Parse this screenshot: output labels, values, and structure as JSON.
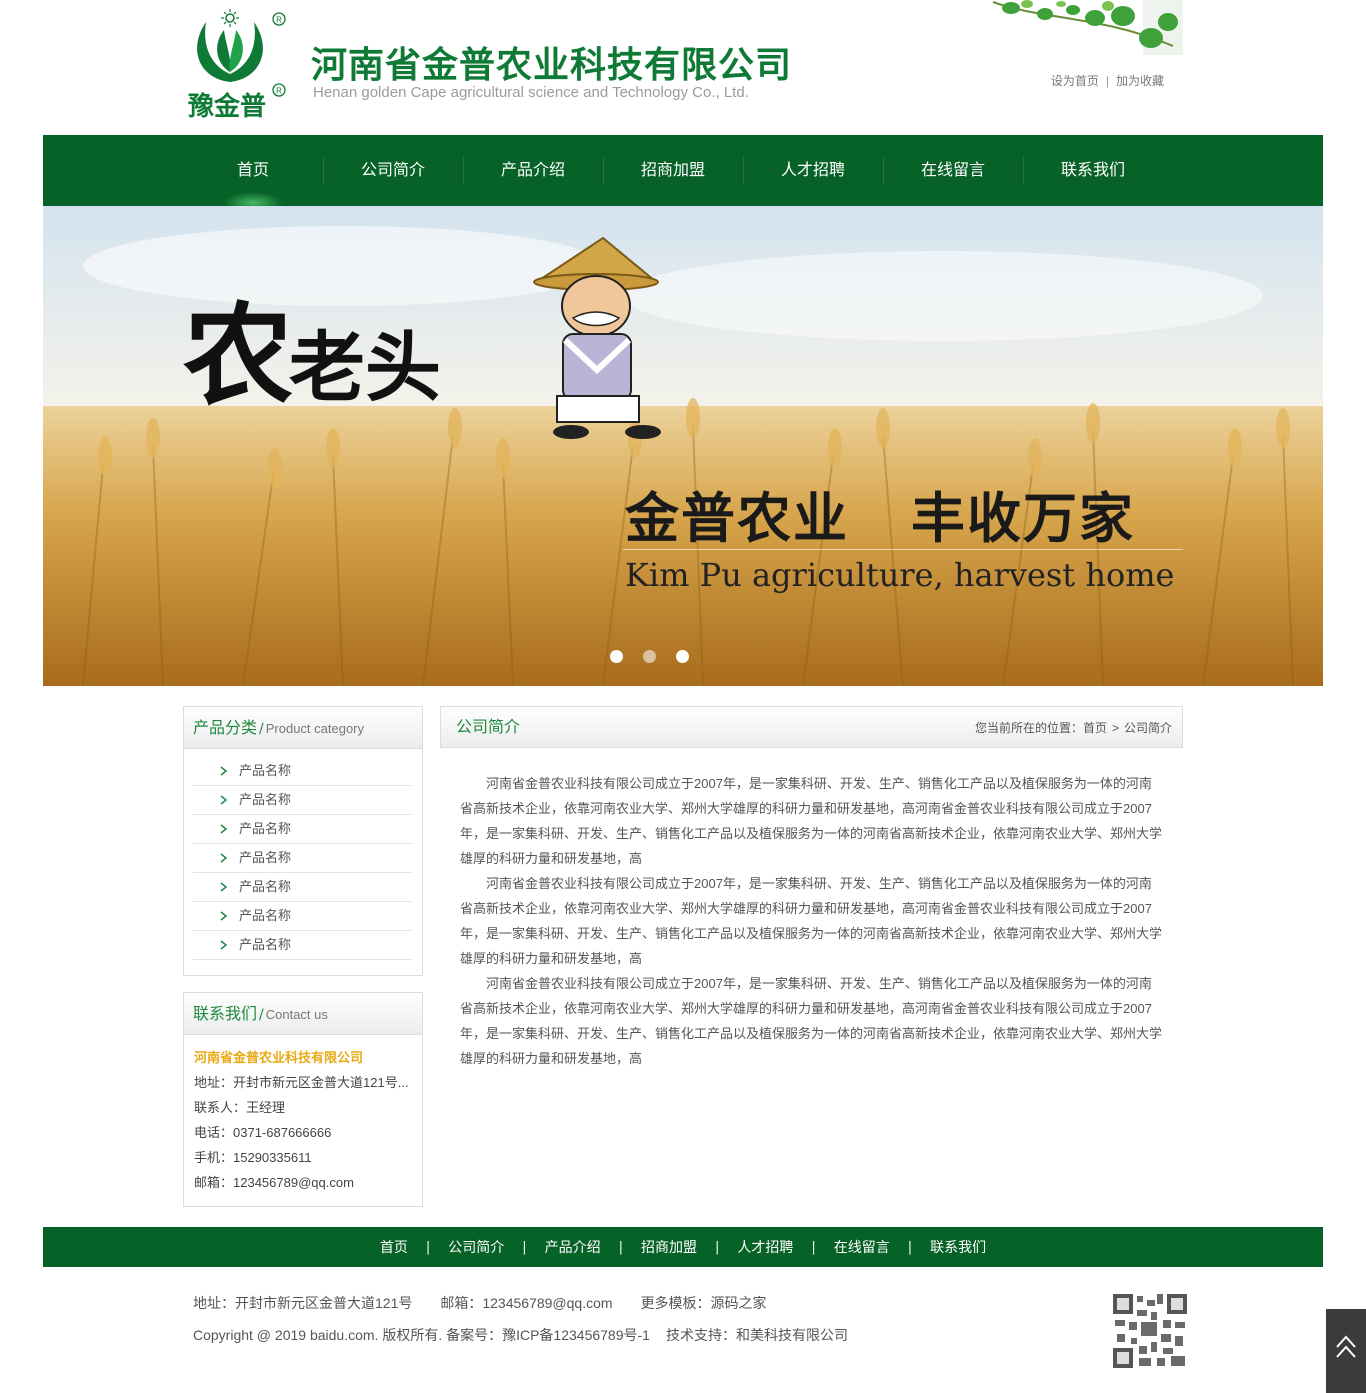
{
  "colors": {
    "brand_green": "#076227",
    "title_green": "#0e7a35",
    "accent_gold": "#e8a915"
  },
  "header": {
    "company_cn": "河南省金普农业科技有限公司",
    "company_en": "Henan golden Cape agricultural science and Technology Co., Ltd.",
    "logo_text": "豫金普",
    "links": {
      "set_home": "设为首页",
      "sep": "|",
      "favorite": "加为收藏"
    }
  },
  "nav": {
    "items": [
      {
        "label": "首页"
      },
      {
        "label": "公司简介"
      },
      {
        "label": "产品介绍"
      },
      {
        "label": "招商加盟"
      },
      {
        "label": "人才招聘"
      },
      {
        "label": "在线留言"
      },
      {
        "label": "联系我们"
      }
    ]
  },
  "banner": {
    "brand_big": "农",
    "brand_small": "老头",
    "slogan_left": "金普农业",
    "slogan_right": "丰收万家",
    "slogan_en": "Kim Pu agriculture, harvest home"
  },
  "sidebar": {
    "category": {
      "title_cn": "产品分类",
      "slash": "/",
      "title_en": "Product category",
      "items": [
        "产品名称",
        "产品名称",
        "产品名称",
        "产品名称",
        "产品名称",
        "产品名称",
        "产品名称"
      ]
    },
    "contact": {
      "title_cn": "联系我们",
      "slash": "/",
      "title_en": "Contact us",
      "company": "河南省金普农业科技有限公司",
      "rows": [
        "地址：开封市新元区金普大道121号...",
        "联系人：王经理",
        "电话：0371-687666666",
        "手机：15290335611",
        "邮箱：123456789@qq.com"
      ]
    }
  },
  "main": {
    "title": "公司简介",
    "crumb": {
      "prefix": "您当前所在的位置：",
      "home": "首页",
      "gt": ">",
      "current": "公司简介"
    },
    "paragraphs": [
      "河南省金普农业科技有限公司成立于2007年，是一家集科研、开发、生产、销售化工产品以及植保服务为一体的河南省高新技术企业，依靠河南农业大学、郑州大学雄厚的科研力量和研发基地，高河南省金普农业科技有限公司成立于2007年，是一家集科研、开发、生产、销售化工产品以及植保服务为一体的河南省高新技术企业，依靠河南农业大学、郑州大学雄厚的科研力量和研发基地，高",
      "河南省金普农业科技有限公司成立于2007年，是一家集科研、开发、生产、销售化工产品以及植保服务为一体的河南省高新技术企业，依靠河南农业大学、郑州大学雄厚的科研力量和研发基地，高河南省金普农业科技有限公司成立于2007年，是一家集科研、开发、生产、销售化工产品以及植保服务为一体的河南省高新技术企业，依靠河南农业大学、郑州大学雄厚的科研力量和研发基地，高",
      "河南省金普农业科技有限公司成立于2007年，是一家集科研、开发、生产、销售化工产品以及植保服务为一体的河南省高新技术企业，依靠河南农业大学、郑州大学雄厚的科研力量和研发基地，高河南省金普农业科技有限公司成立于2007年，是一家集科研、开发、生产、销售化工产品以及植保服务为一体的河南省高新技术企业，依靠河南农业大学、郑州大学雄厚的科研力量和研发基地，高"
    ]
  },
  "footer": {
    "nav": [
      "首页",
      "公司简介",
      "产品介绍",
      "招商加盟",
      "人才招聘",
      "在线留言",
      "联系我们"
    ],
    "sep": "|",
    "address": "地址：开封市新元区金普大道121号",
    "email": "邮箱：123456789@qq.com",
    "more": "更多模板：源码之家",
    "copyright": "Copyright @ 2019 baidu.com. 版权所有. 备案号：豫ICP备123456789号-1",
    "support": "技术支持：和美科技有限公司"
  },
  "icons": {
    "logo": "leaf-logo-icon",
    "category_arrow": "chevron-right-icon",
    "back_to_top": "double-chevron-up-icon",
    "qr": "qr-code-icon"
  }
}
